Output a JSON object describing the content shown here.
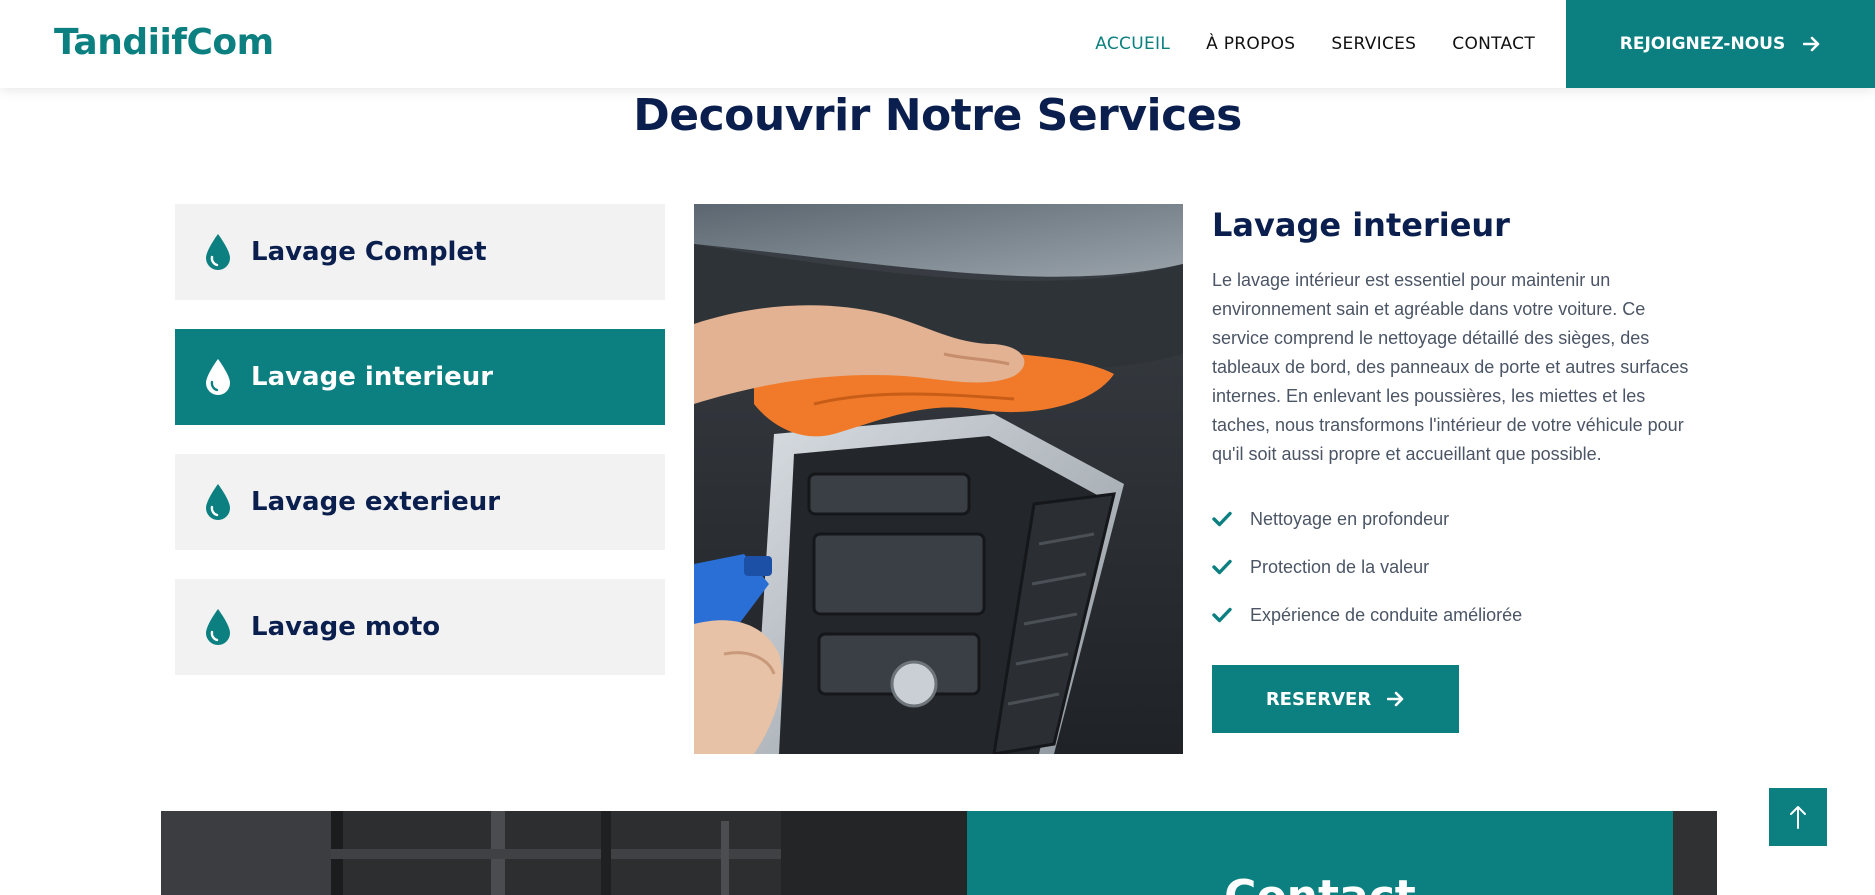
{
  "navbar": {
    "brand": "TandiifCom",
    "links": [
      {
        "label": "ACCUEIL",
        "active": true
      },
      {
        "label": "À PROPOS",
        "active": false
      },
      {
        "label": "SERVICES",
        "active": false
      },
      {
        "label": "CONTACT",
        "active": false
      }
    ],
    "join_label": "REJOIGNEZ-NOUS"
  },
  "section": {
    "title": "Decouvrir Notre Services"
  },
  "services": [
    {
      "label": "Lavage Complet",
      "active": false
    },
    {
      "label": "Lavage interieur",
      "active": true
    },
    {
      "label": "Lavage exterieur",
      "active": false
    },
    {
      "label": "Lavage moto",
      "active": false
    }
  ],
  "detail": {
    "title": "Lavage interieur",
    "description": "Le lavage intérieur est essentiel pour maintenir un environnement sain et agréable dans votre voiture. Ce service comprend le nettoyage détaillé des sièges, des tableaux de bord, des panneaux de porte et autres surfaces internes. En enlevant les poussières, les miettes et les taches, nous transformons l'intérieur de votre véhicule pour qu'il soit aussi propre et accueillant que possible.",
    "features": [
      "Nettoyage en profondeur",
      "Protection de la valeur",
      "Expérience de conduite améliorée"
    ],
    "reserve_label": "RESERVER"
  },
  "contact": {
    "heading": "Contact"
  },
  "colors": {
    "accent": "#0c7f80",
    "navy": "#0b1f4f",
    "tab_bg": "#f2f2f2",
    "body_text": "#4b5566"
  },
  "icons": {
    "tab": "water-drop-icon",
    "feature": "check-icon",
    "button": "arrow-right-icon",
    "back_to_top": "arrow-up-icon"
  }
}
